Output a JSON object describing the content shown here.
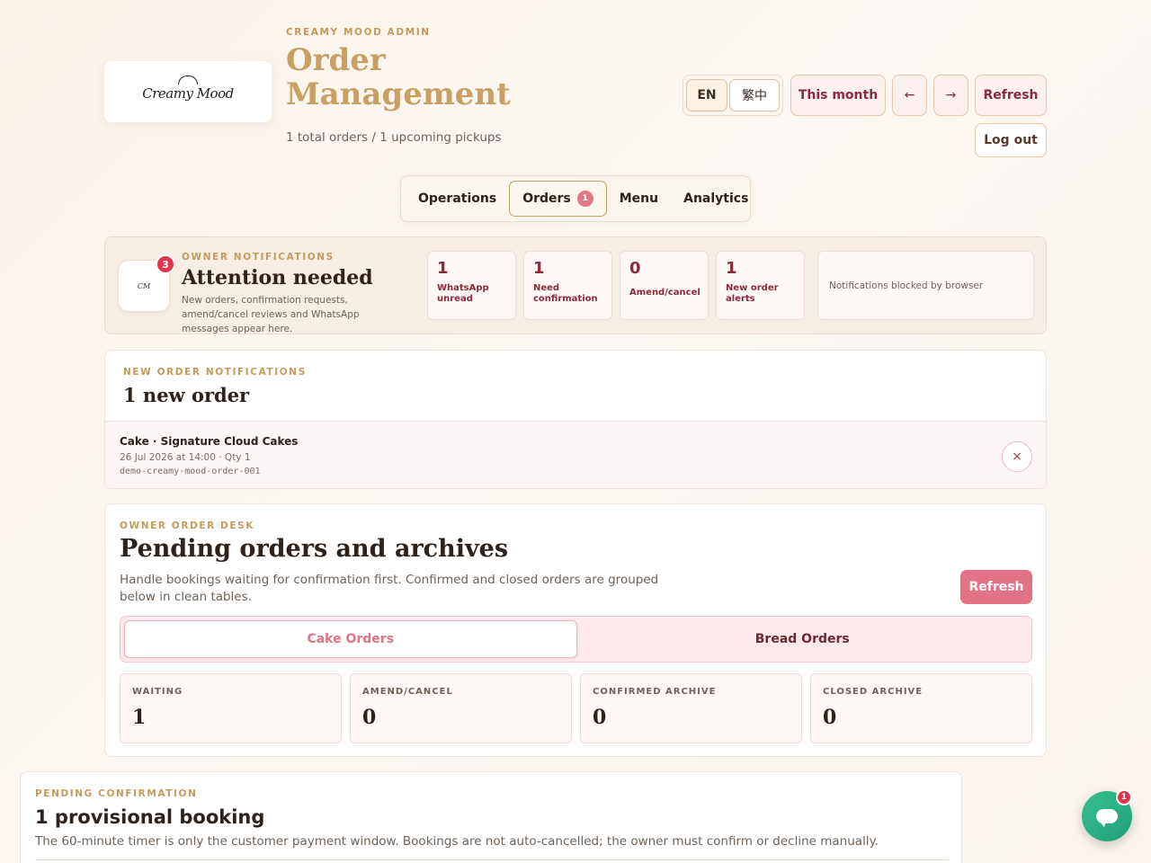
{
  "header": {
    "logo_alt": "Creamy Mood",
    "eyebrow": "CREAMY MOOD ADMIN",
    "title": "Order Management",
    "subtitle": "1 total orders / 1 upcoming pickups",
    "lang_en": "EN",
    "lang_zh": "繁中",
    "this_month": "This month",
    "prev": "←",
    "next": "→",
    "refresh": "Refresh",
    "logout": "Log out"
  },
  "tabs": [
    {
      "label": "Operations"
    },
    {
      "label": "Orders",
      "count": "1"
    },
    {
      "label": "Menu"
    },
    {
      "label": "Analytics"
    }
  ],
  "owner_notifications": {
    "badge": "3",
    "eyebrow": "OWNER NOTIFICATIONS",
    "title": "Attention needed",
    "description": "New orders, confirmation requests, amend/cancel reviews and WhatsApp messages appear here.",
    "stats": [
      {
        "value": "1",
        "label": "WhatsApp unread"
      },
      {
        "value": "1",
        "label": "Need confirmation"
      },
      {
        "value": "0",
        "label": "Amend/cancel"
      },
      {
        "value": "1",
        "label": "New order alerts"
      }
    ],
    "browser_note": "Notifications blocked by browser"
  },
  "new_orders": {
    "eyebrow": "NEW ORDER NOTIFICATIONS",
    "title": "1 new order",
    "items": [
      {
        "name": "Cake · Signature Cloud Cakes",
        "meta": "26 Jul 2026 at 14:00 · Qty 1",
        "id": "demo-creamy-mood-order-001",
        "dismiss": "×"
      }
    ]
  },
  "order_desk": {
    "eyebrow": "OWNER ORDER DESK",
    "title": "Pending orders and archives",
    "description": "Handle bookings waiting for confirmation first. Confirmed and closed orders are grouped below in clean tables.",
    "refresh": "Refresh",
    "segments": [
      "Cake Orders",
      "Bread Orders"
    ],
    "kpis": [
      {
        "label": "WAITING",
        "value": "1"
      },
      {
        "label": "AMEND/CANCEL",
        "value": "0"
      },
      {
        "label": "CONFIRMED ARCHIVE",
        "value": "0"
      },
      {
        "label": "CLOSED ARCHIVE",
        "value": "0"
      }
    ]
  },
  "pending": {
    "eyebrow": "PENDING CONFIRMATION",
    "title": "1 provisional booking",
    "description": "The 60-minute timer is only the customer payment window. Bookings are not auto-cancelled; the owner must confirm or decline manually."
  },
  "chat": {
    "badge": "1"
  },
  "colors": {
    "gold": "#c9a063",
    "wine": "#8b2a3a",
    "pink_accent": "#e27386",
    "badge_red": "#e2344d",
    "chat_green": "#37c08f"
  },
  "icons": [
    "logo-image",
    "bell-logo",
    "close-icon",
    "chat-icon"
  ]
}
